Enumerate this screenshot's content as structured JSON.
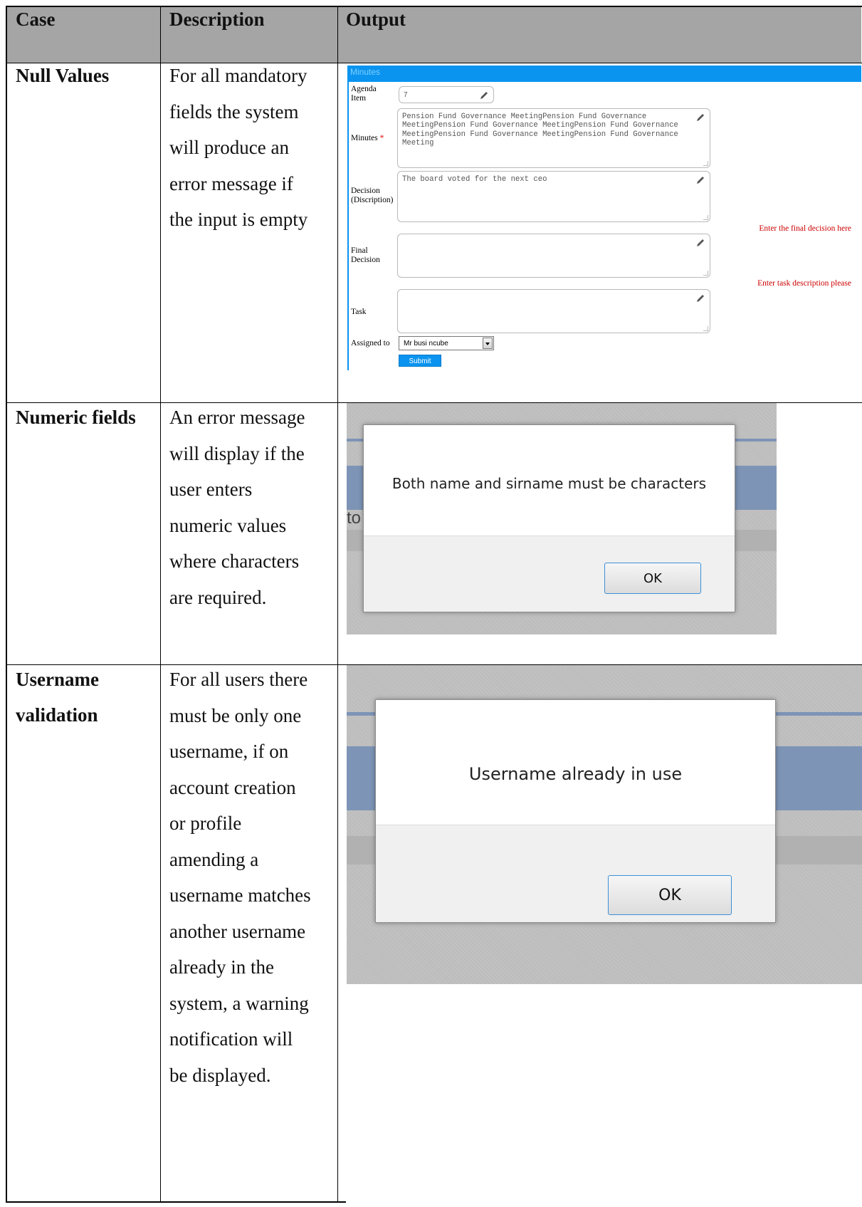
{
  "table": {
    "headers": {
      "case": "Case",
      "description": "Description",
      "output": "Output"
    },
    "rows": [
      {
        "case": "Null Values",
        "description": [
          "For all mandatory",
          "fields the system",
          "will produce an",
          "error message if",
          "the input is empty"
        ]
      },
      {
        "case": "Numeric fields",
        "description": [
          "An error message",
          "will display if the",
          "user enters",
          "numeric values",
          "where characters",
          "are required."
        ]
      },
      {
        "case": [
          "Username",
          "validation"
        ],
        "description": [
          "For all users there",
          "must be only one",
          "username, if on",
          "account creation",
          "or profile",
          "amending a",
          "username matches",
          "another username",
          "already in the",
          "system, a warning",
          "notification will",
          "be displayed."
        ]
      }
    ]
  },
  "minutes_form": {
    "title": "Minutes",
    "agenda_label": [
      "Agenda",
      "Item"
    ],
    "agenda_value": "7",
    "minutes_label": "Minutes",
    "required_mark": "*",
    "minutes_value": [
      "Pension Fund Governance MeetingPension Fund Governance",
      "MeetingPension Fund Governance MeetingPension Fund Governance",
      "MeetingPension Fund Governance MeetingPension Fund Governance",
      "Meeting"
    ],
    "decision_label": [
      "Decision",
      "(Discription)"
    ],
    "decision_value": "The board voted for the next ceo",
    "decision_error": "Enter the final decision here",
    "final_label": [
      "Final",
      "Decision"
    ],
    "final_value": "",
    "final_error": "Enter task description please",
    "task_label": "Task",
    "task_value": "",
    "assigned_label": "Assigned to",
    "assigned_value": "Mr busi ncube",
    "submit_label": "Submit",
    "accent": "#0a94f0",
    "error_color": "#cc0000"
  },
  "alert_numeric": {
    "message": "Both name and sirname must be characters",
    "ok_label": "OK",
    "background_fragment": "to"
  },
  "alert_username": {
    "message": "Username already in use",
    "ok_label": "OK"
  },
  "colors": {
    "header_bg": "#a5a5a5",
    "dialog_bar": "#7d94b6"
  }
}
